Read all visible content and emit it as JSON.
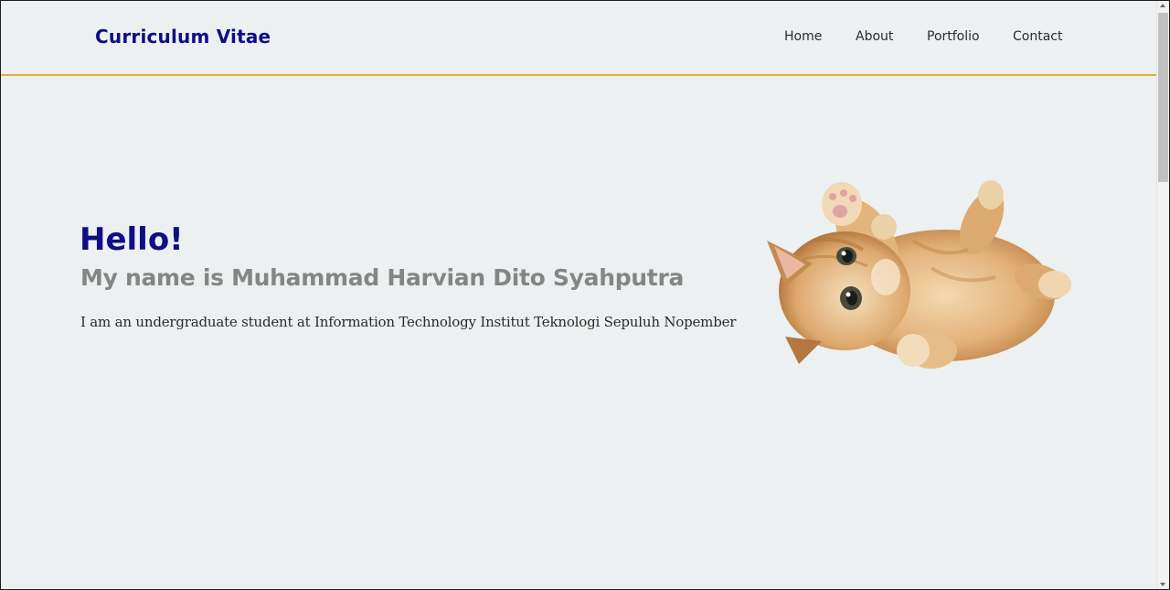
{
  "header": {
    "brand": "Curriculum Vitae",
    "nav": {
      "home": "Home",
      "about": "About",
      "portfolio": "Portfolio",
      "contact": "Contact"
    }
  },
  "hero": {
    "greeting": "Hello!",
    "name": "My name is Muhammad Harvian Dito Syahputra",
    "description": "I am an undergraduate student at Information Technology Institut Teknologi Sepuluh Nopember",
    "image_icon": "kitten-image"
  },
  "colors": {
    "brand": "#0d0f86",
    "accent_line": "#e0b02e",
    "background": "#ecf0f1",
    "name_gray": "#858585"
  }
}
